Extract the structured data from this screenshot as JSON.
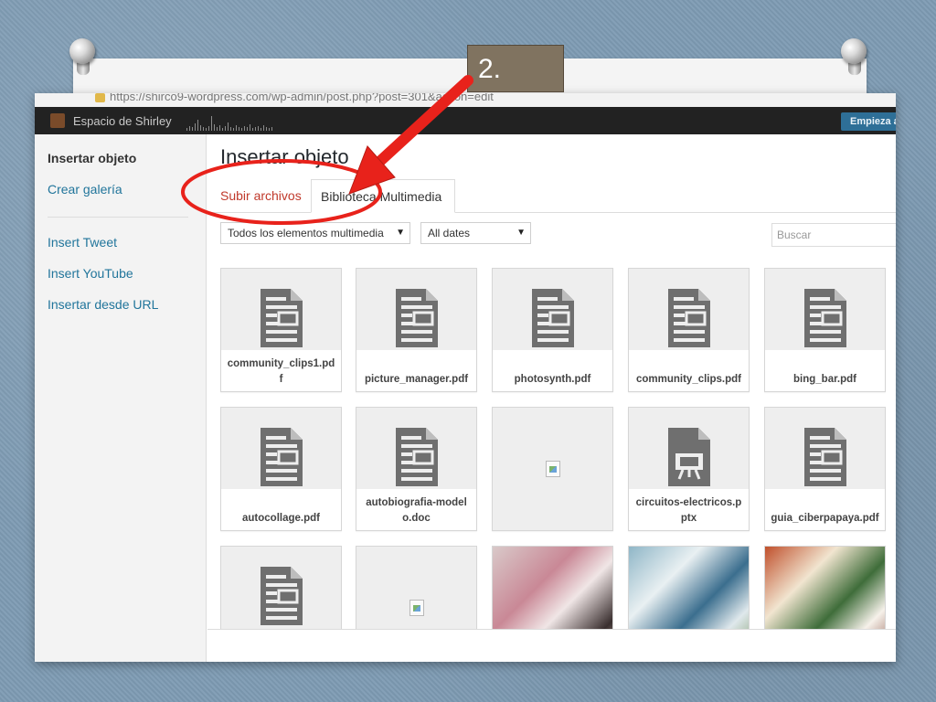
{
  "browser": {
    "url": "https://shirco9-wordpress.com/wp-admin/post.php?post=301&action=edit"
  },
  "admin_bar": {
    "site_name": "Espacio de Shirley",
    "start_button": "Empieza a"
  },
  "sidebar": {
    "items": [
      {
        "label": "Insertar objeto",
        "active": true
      },
      {
        "label": "Crear galería"
      },
      {
        "label": "Insert Tweet"
      },
      {
        "label": "Insert YouTube"
      },
      {
        "label": "Insertar desde URL"
      }
    ]
  },
  "main": {
    "title": "Insertar objeto",
    "tabs": [
      {
        "label": "Subir archivos"
      },
      {
        "label": "Biblioteca Multimedia",
        "active": true
      }
    ],
    "filters": {
      "type_selected": "Todos los elementos multimedia",
      "date_selected": "All dates"
    },
    "search": {
      "placeholder": "Buscar"
    },
    "items": [
      {
        "name": "community_clips1.pdf",
        "kind": "document-icon"
      },
      {
        "name": "picture_manager.pdf",
        "kind": "document-icon"
      },
      {
        "name": "photosynth.pdf",
        "kind": "document-icon"
      },
      {
        "name": "community_clips.pdf",
        "kind": "document-icon"
      },
      {
        "name": "bing_bar.pdf",
        "kind": "document-icon"
      },
      {
        "name": "autocollage.pdf",
        "kind": "document-icon"
      },
      {
        "name": "autobiografia-modelo.doc",
        "kind": "document-icon"
      },
      {
        "name": "",
        "kind": "broken-image-icon"
      },
      {
        "name": "circuitos-electricos.pptx",
        "kind": "presentation-icon"
      },
      {
        "name": "guia_ciberpapaya.pdf",
        "kind": "document-icon"
      },
      {
        "name": "",
        "kind": "document-icon"
      },
      {
        "name": "",
        "kind": "broken-image-icon"
      },
      {
        "name": "",
        "kind": "photo-thumbnail"
      },
      {
        "name": "",
        "kind": "photo-thumbnail"
      },
      {
        "name": "",
        "kind": "photo-thumbnail"
      }
    ]
  },
  "annotation": {
    "callout_text": "2.",
    "arrow_color": "#e8221b",
    "circle_color": "#e8221b"
  },
  "colors": {
    "link": "#21759b",
    "active_tab_text": "#c0392b",
    "admin_bar": "#222222",
    "callout_bg": "#807360"
  }
}
